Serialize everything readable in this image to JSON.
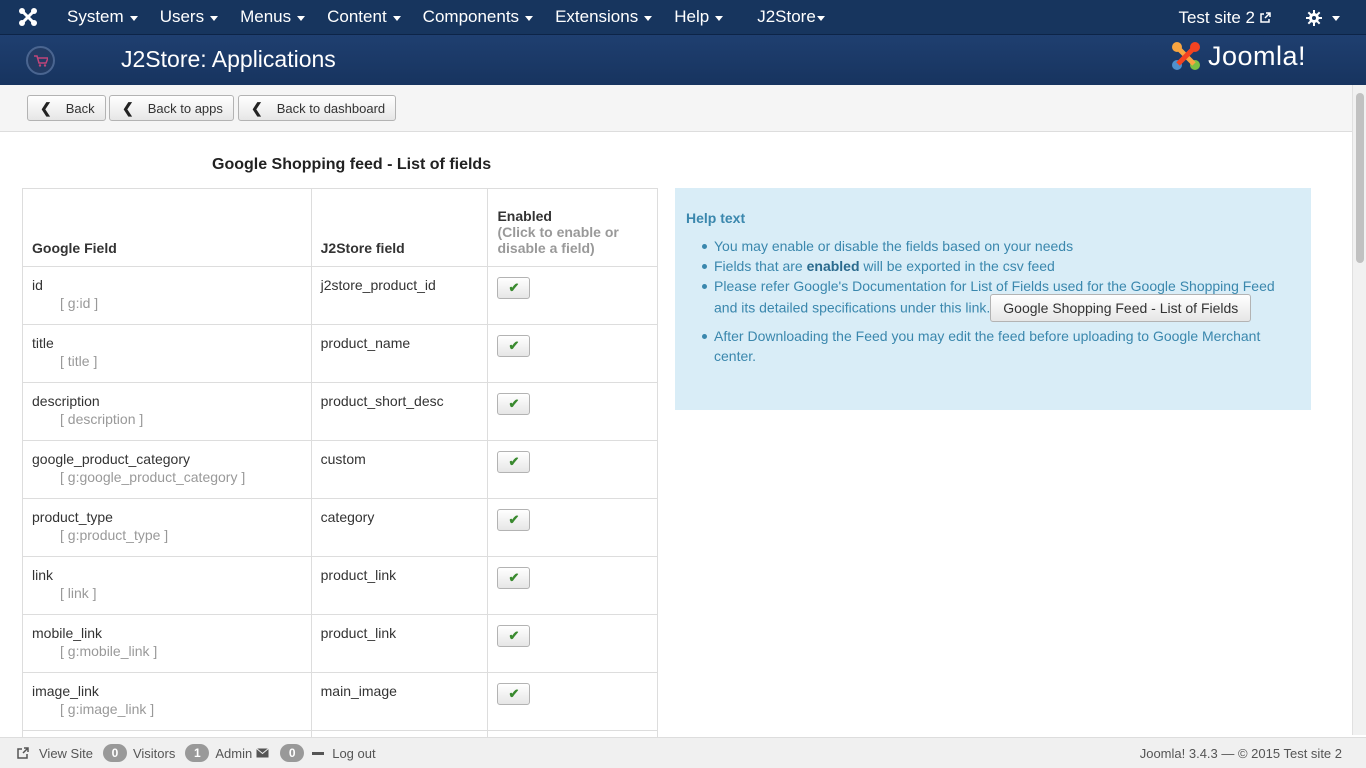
{
  "navbar": {
    "menus": [
      "System",
      "Users",
      "Menus",
      "Content",
      "Components",
      "Extensions",
      "Help",
      "J2Store"
    ],
    "site_link": "Test site 2"
  },
  "header": {
    "title": "J2Store: Applications",
    "brand": "Joomla!"
  },
  "toolbar": {
    "back": "Back",
    "back_to_apps": "Back to apps",
    "back_to_dashboard": "Back to dashboard"
  },
  "section_title": "Google Shopping feed - List of fields",
  "table": {
    "headers": {
      "google_field": "Google Field",
      "j2store_field": "J2Store field",
      "enabled": "Enabled",
      "enabled_sub": "(Click to enable or disable a field)"
    },
    "rows": [
      {
        "field": "id",
        "tag": "[ g:id ]",
        "j2": "j2store_product_id"
      },
      {
        "field": "title",
        "tag": "[ title ]",
        "j2": "product_name"
      },
      {
        "field": "description",
        "tag": "[ description ]",
        "j2": "product_short_desc"
      },
      {
        "field": "google_product_category",
        "tag": "[ g:google_product_category ]",
        "j2": "custom"
      },
      {
        "field": "product_type",
        "tag": "[ g:product_type ]",
        "j2": "category"
      },
      {
        "field": "link",
        "tag": "[ link ]",
        "j2": "product_link"
      },
      {
        "field": "mobile_link",
        "tag": "[ g:mobile_link ]",
        "j2": "product_link"
      },
      {
        "field": "image_link",
        "tag": "[ g:image_link ]",
        "j2": "main_image"
      }
    ]
  },
  "help": {
    "title": "Help text",
    "item1": "You may enable or disable the fields based on your needs",
    "item2_pre": "Fields that are ",
    "item2_bold": "enabled",
    "item2_post": " will be exported in the csv feed",
    "item3": "Please refer Google's Documentation for List of Fields used for the Google Shopping Feed and its detailed specifications under this link.",
    "item3_button": "Google Shopping Feed - List of Fields",
    "item4": "After Downloading the Feed you may edit the feed before uploading to Google Merchant center."
  },
  "footer": {
    "view_site": "View Site",
    "visitors_count": "0",
    "visitors": "Visitors",
    "admin_count": "1",
    "admin": "Admin",
    "messages_count": "0",
    "logout": "Log out",
    "version": "Joomla! 3.4.3  —  © 2015 Test site 2"
  },
  "colors": {
    "navbar": "#17355e",
    "help_bg": "#d9edf7",
    "help_text": "#3a87ad",
    "check": "#3a8a2f"
  }
}
